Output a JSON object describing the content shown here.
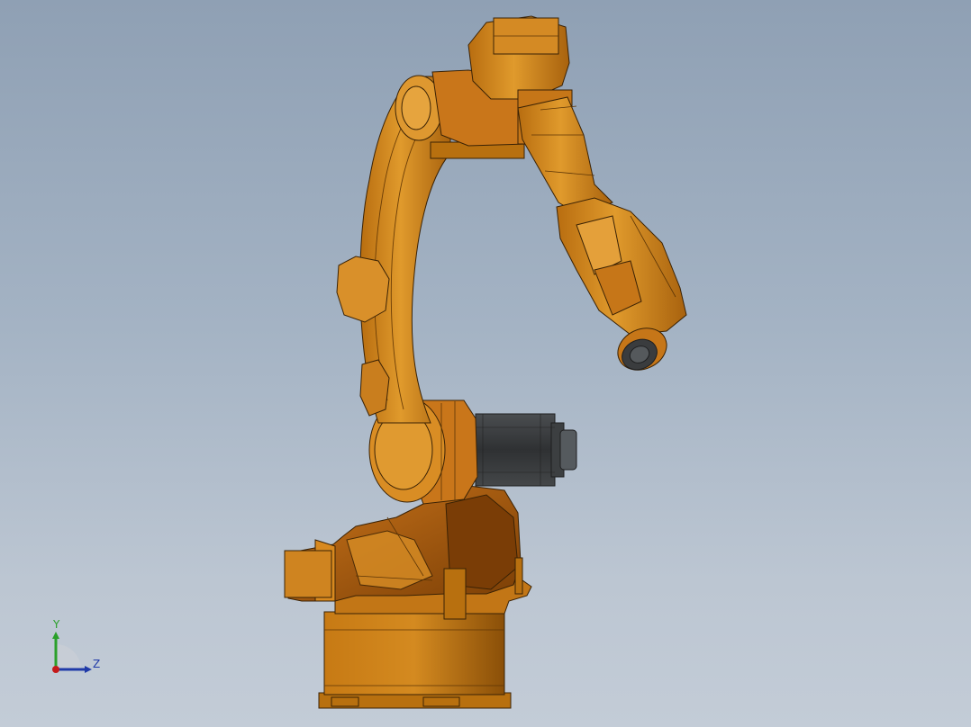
{
  "viewport": {
    "background_top": "#8fa0b4",
    "background_bottom": "#c3ccd7"
  },
  "model": {
    "name": "robot-arm-model",
    "body_color": "#d88a1c",
    "body_shade": "#9b5a0c",
    "outline_color": "#3a2205",
    "motor_color": "#3c3f41"
  },
  "triad": {
    "y_label": "Y",
    "z_label": "Z",
    "y_color": "#2aa02a",
    "z_color": "#1f3aa8",
    "x_color": "#c41a1a"
  }
}
